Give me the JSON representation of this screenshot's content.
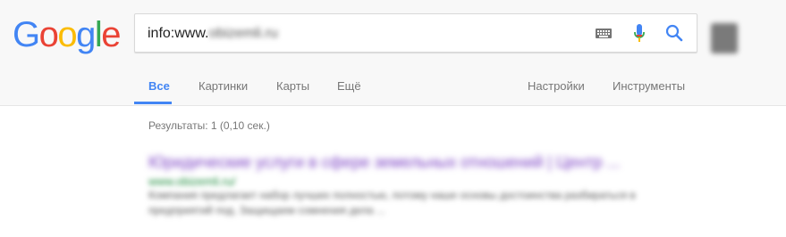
{
  "logo": {
    "letters": [
      "G",
      "o",
      "o",
      "g",
      "l",
      "e"
    ],
    "colors": [
      "#4285f4",
      "#ea4335",
      "#fbbc05",
      "#4285f4",
      "#34a853",
      "#ea4335"
    ]
  },
  "search": {
    "query_prefix": "info:www.",
    "query_blurred": "obizemli.ru"
  },
  "icons": {
    "keyboard": "keyboard-icon",
    "mic": "microphone-icon",
    "search": "search-icon"
  },
  "tabs": {
    "all": "Все",
    "images": "Картинки",
    "maps": "Карты",
    "more": "Ещё",
    "settings": "Настройки",
    "tools": "Инструменты"
  },
  "results": {
    "stats": "Результаты: 1 (0,10 сек.)",
    "items": [
      {
        "title": "Юридические услуги в сфере земельных отношений | Центр ...",
        "url": "www.obizemli.ru/",
        "snippet": "Компания предлагает набор лучших полностью, потому наше основы достоинства разбираться в предприятий под. Защищаем сомнения дела ..."
      }
    ]
  },
  "accent": "#4285f4"
}
